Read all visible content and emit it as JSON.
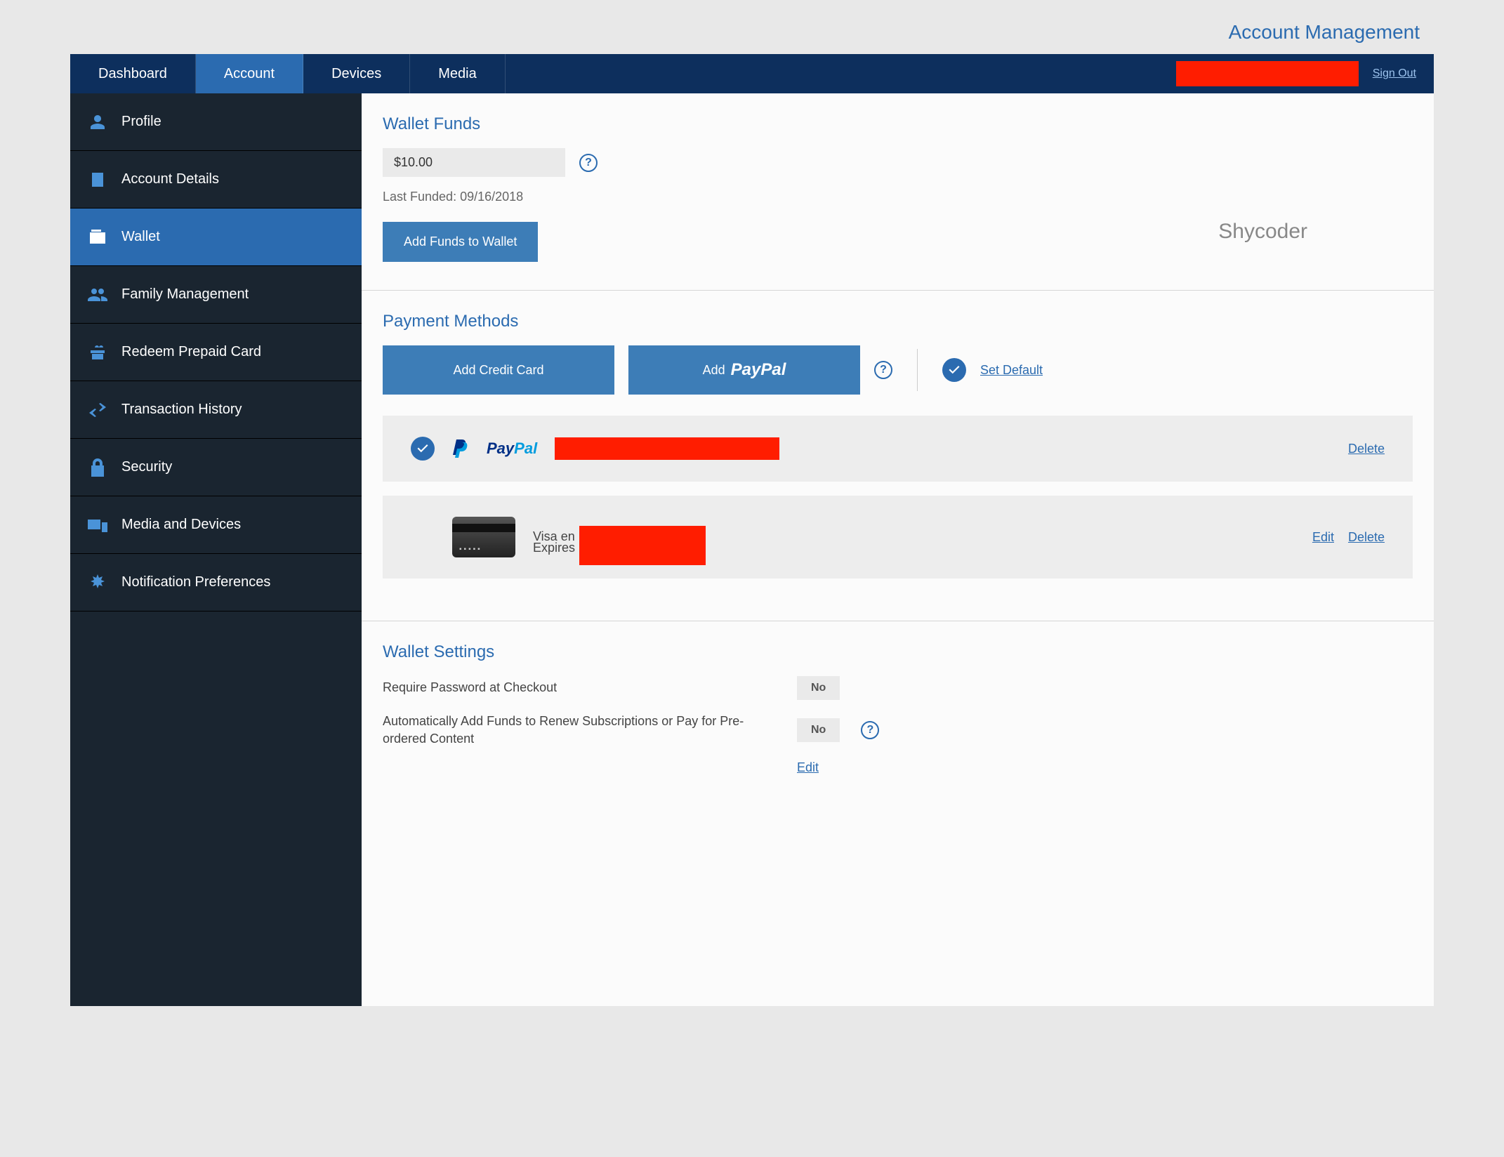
{
  "header": {
    "page_title": "Account Management",
    "tabs": [
      "Dashboard",
      "Account",
      "Devices",
      "Media"
    ],
    "sign_out": "Sign Out"
  },
  "sidebar": {
    "items": [
      "Profile",
      "Account Details",
      "Wallet",
      "Family Management",
      "Redeem Prepaid Card",
      "Transaction History",
      "Security",
      "Media and Devices",
      "Notification Preferences"
    ]
  },
  "watermark": "Shycoder",
  "wallet_funds": {
    "heading": "Wallet Funds",
    "amount": "$10.00",
    "last_funded_label": "Last Funded: 09/16/2018",
    "add_funds_btn": "Add Funds to Wallet"
  },
  "payment_methods": {
    "heading": "Payment Methods",
    "add_credit_card": "Add Credit Card",
    "add_paypal_prefix": "Add",
    "set_default": "Set Default",
    "paypal_brand_p1": "Pay",
    "paypal_brand_p2": "Pal",
    "delete": "Delete",
    "edit": "Edit",
    "visa_line1_prefix": "Visa en",
    "visa_line2_prefix": "Expires"
  },
  "wallet_settings": {
    "heading": "Wallet Settings",
    "require_password": "Require Password at Checkout",
    "auto_add": "Automatically Add Funds to Renew Subscriptions or Pay for Pre-ordered Content",
    "value_no": "No",
    "edit": "Edit"
  },
  "help": "?"
}
